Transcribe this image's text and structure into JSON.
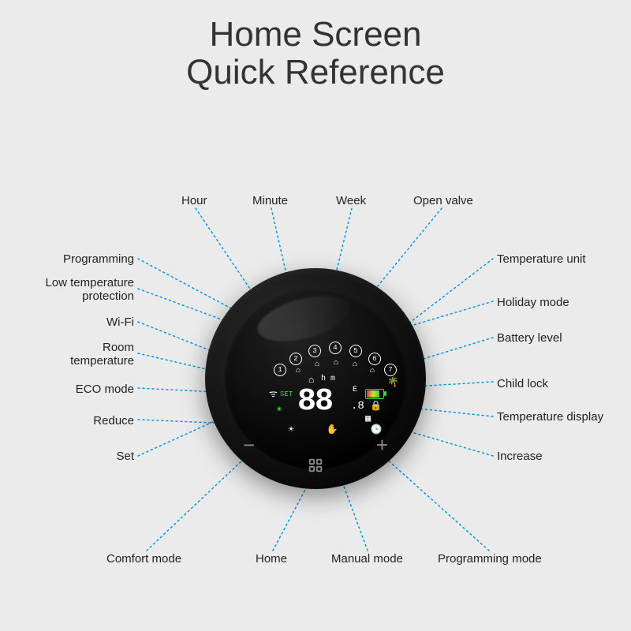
{
  "title_line1": "Home Screen",
  "title_line2": "Quick Reference",
  "callouts": {
    "hour": "Hour",
    "minute": "Minute",
    "week": "Week",
    "open_valve": "Open valve",
    "programming": "Programming",
    "low_temp": "Low temperature\nprotection",
    "wifi": "Wi-Fi",
    "room_temp": "Room\ntemperature",
    "eco": "ECO mode",
    "reduce": "Reduce",
    "set": "Set",
    "comfort": "Comfort  mode",
    "home": "Home",
    "manual": "Manual mode",
    "prog_mode": "Programming mode",
    "temp_unit": "Temperature unit",
    "holiday": "Holiday mode",
    "battery": "Battery level",
    "child_lock": "Child lock",
    "temp_display": "Temperature display",
    "increase": "Increase"
  },
  "display": {
    "main_temp": "88",
    "small_temp": ".8",
    "unit": "E",
    "room_set_label": "SET",
    "hm": "h  m",
    "arc_numbers": [
      "1",
      "2",
      "3",
      "4",
      "5",
      "6",
      "7"
    ]
  }
}
